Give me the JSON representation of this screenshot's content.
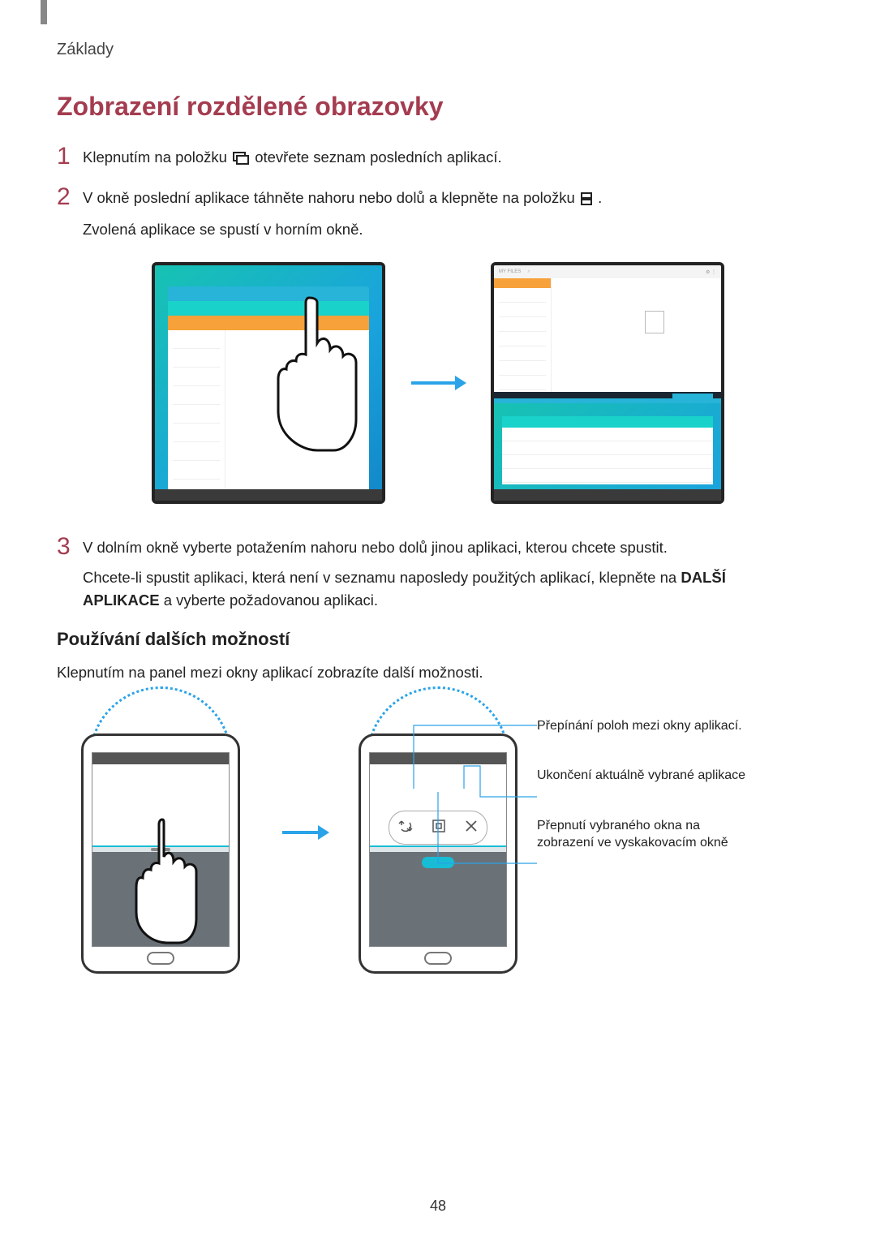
{
  "breadcrumb": "Základy",
  "section_title": "Zobrazení rozdělené obrazovky",
  "steps": {
    "s1": {
      "num": "1",
      "text_a": "Klepnutím na položku ",
      "text_b": " otevřete seznam posledních aplikací."
    },
    "s2": {
      "num": "2",
      "text_a": "V okně poslední aplikace táhněte nahoru nebo dolů a klepněte na položku ",
      "text_b": ".",
      "text_c": "Zvolená aplikace se spustí v horním okně."
    },
    "s3_num": "3",
    "s3_a": "V dolním okně vyberte potažením nahoru nebo dolů jinou aplikaci, kterou chcete spustit.",
    "s3_b_pre": "Chcete-li spustit aplikaci, která není v seznamu naposledy použitých aplikací, klepněte na ",
    "s3_b_bold1": "DALŠÍ APLIKACE",
    "s3_b_post": " a vyberte požadovanou aplikaci."
  },
  "sub_title": "Používání dalších možností",
  "sub_body": "Klepnutím na panel mezi okny aplikací zobrazíte další možnosti.",
  "callouts": {
    "c1": "Přepínání poloh mezi okny aplikací.",
    "c2": "Ukončení aktuálně vybrané aplikace",
    "c3": "Přepnutí vybraného okna na zobrazení ve vyskakovacím okně"
  },
  "page_number": "48"
}
